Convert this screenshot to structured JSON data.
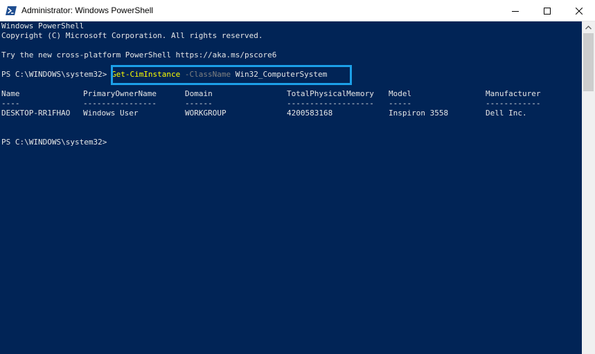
{
  "window": {
    "title": "Administrator: Windows PowerShell"
  },
  "console": {
    "banner_line1": "Windows PowerShell",
    "banner_line2": "Copyright (C) Microsoft Corporation. All rights reserved.",
    "banner_line3": "Try the new cross-platform PowerShell https://aka.ms/pscore6",
    "prompt": "PS C:\\WINDOWS\\system32>",
    "command": {
      "cmdlet": "Get-CimInstance",
      "parameter": "-ClassName",
      "argument": "Win32_ComputerSystem"
    },
    "table": {
      "headers": [
        "Name",
        "PrimaryOwnerName",
        "Domain",
        "TotalPhysicalMemory",
        "Model",
        "Manufacturer"
      ],
      "separators": [
        "----",
        "----------------",
        "------",
        "-------------------",
        "-----",
        "------------"
      ],
      "rows": [
        [
          "DESKTOP-RR1FHAO",
          "Windows User",
          "WORKGROUP",
          "4200583168",
          "Inspiron 3558",
          "Dell Inc."
        ]
      ]
    },
    "final_prompt": "PS C:\\WINDOWS\\system32>"
  },
  "colors": {
    "console_background": "#012456",
    "console_text": "#e6e6e6",
    "cmdlet": "#ffff00",
    "parameter": "#808080",
    "highlight_border": "#1ca0e8"
  },
  "icons": {
    "app": "powershell-icon",
    "minimize": "minimize-icon",
    "maximize": "maximize-icon",
    "close": "close-icon",
    "scroll_up": "arrow-up-icon"
  }
}
